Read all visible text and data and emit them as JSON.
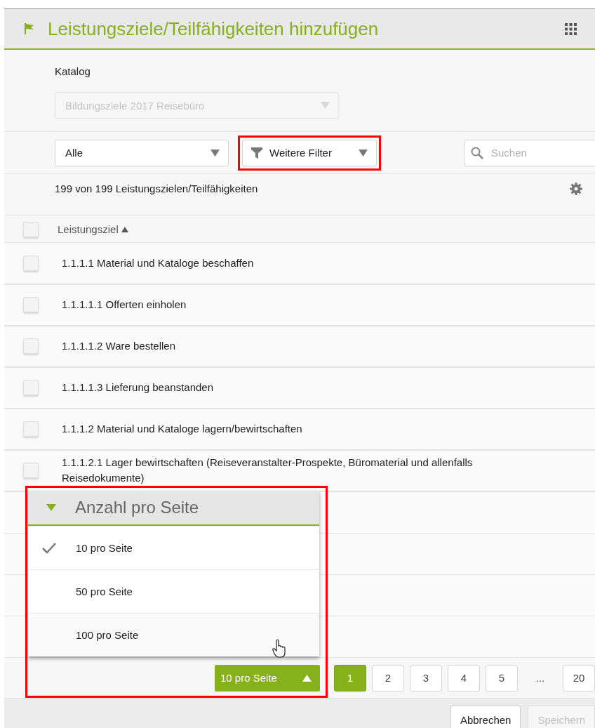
{
  "header": {
    "title": "Leistungsziele/Teilfähigkeiten hinzufügen"
  },
  "catalog": {
    "label": "Katalog",
    "value": "Bildungsziele 2017 Reisebüro",
    "disabled": true
  },
  "filters": {
    "type_select": {
      "value": "Alle"
    },
    "more_filters": {
      "label": "Weitere Filter",
      "highlighted": true
    },
    "search": {
      "placeholder": "Suchen"
    }
  },
  "result_count": "199 von 199 Leistungszielen/Teilfähigkeiten",
  "table": {
    "select_all_checked": false,
    "column": {
      "label": "Leistungsziel",
      "sort_ascending": true
    },
    "rows": [
      {
        "label": "1.1.1.1 Material und Kataloge beschaffen",
        "checked": false
      },
      {
        "label": "1.1.1.1.1 Offerten einholen",
        "checked": false
      },
      {
        "label": "1.1.1.1.2 Ware bestellen",
        "checked": false
      },
      {
        "label": "1.1.1.1.3 Lieferung beanstanden",
        "checked": false
      },
      {
        "label": "1.1.1.2 Material und Kataloge lagern/bewirtschaften",
        "checked": false
      },
      {
        "label": "1.1.1.2.1 Lager bewirtschaften (Reiseveranstalter-Prospekte, Büromaterial und allenfalls Reisedokumente)",
        "checked": false
      }
    ]
  },
  "pagination": {
    "page_size": {
      "label": "10 pro Seite",
      "expanded": true,
      "highlighted": true
    },
    "popup": {
      "title": "Anzahl pro Seite",
      "options": [
        {
          "label": "10 pro Seite",
          "selected": true
        },
        {
          "label": "50 pro Seite",
          "selected": false
        },
        {
          "label": "100 pro Seite",
          "selected": false
        }
      ]
    },
    "pages": [
      {
        "kind": "page",
        "label": "1",
        "selected": true
      },
      {
        "kind": "page",
        "label": "2",
        "selected": false
      },
      {
        "kind": "page",
        "label": "3",
        "selected": false
      },
      {
        "kind": "page",
        "label": "4",
        "selected": false
      },
      {
        "kind": "page",
        "label": "5",
        "selected": false
      },
      {
        "kind": "ellipsis",
        "label": "...",
        "selected": false
      },
      {
        "kind": "page",
        "label": "20",
        "selected": false
      }
    ]
  },
  "footer": {
    "buttons": [
      {
        "label": "Abbrechen",
        "disabled": false
      },
      {
        "label": "Speichern",
        "disabled": true
      }
    ]
  }
}
